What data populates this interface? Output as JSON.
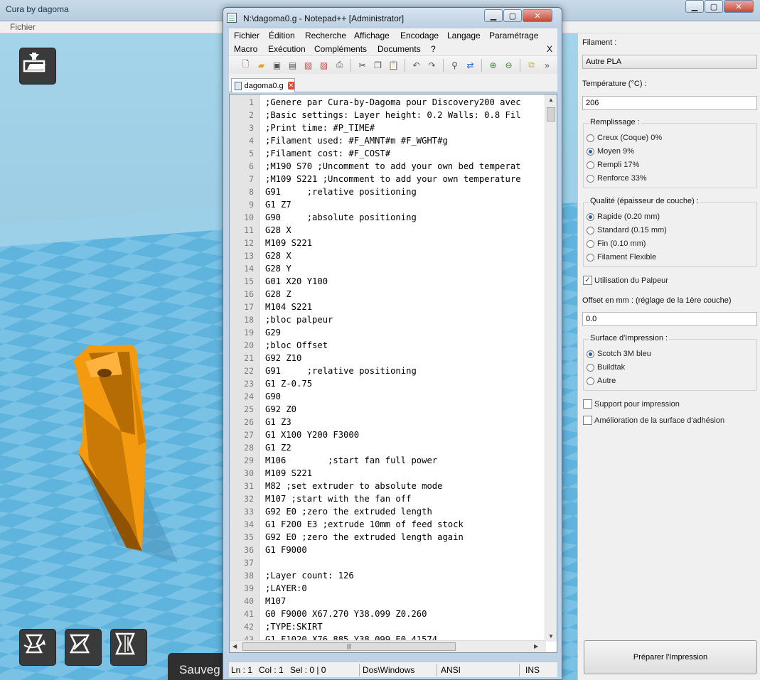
{
  "cura": {
    "title": "Cura by dagoma",
    "menu_fichier": "Fichier",
    "save_toast": "Sauveg"
  },
  "settings": {
    "filament_label": "Filament :",
    "filament_value": "Autre PLA",
    "temperature_label": "Température (°C) :",
    "temperature_value": "206",
    "remplissage": {
      "title": "Remplissage :",
      "options": [
        "Creux (Coque) 0%",
        "Moyen 9%",
        "Rempli 17%",
        "Renforce 33%"
      ],
      "selected_index": 1
    },
    "qualite": {
      "title": "Qualité (épaisseur de couche) :",
      "options": [
        "Rapide (0.20 mm)",
        "Standard (0.15 mm)",
        "Fin (0.10 mm)",
        "Filament Flexible"
      ],
      "selected_index": 0
    },
    "palpeur": {
      "label": "Utilisation du Palpeur",
      "checked": true
    },
    "offset_label": "Offset en mm : (réglage de la 1ère couche)",
    "offset_value": "0.0",
    "surface": {
      "title": "Surface d'Impression :",
      "options": [
        "Scotch 3M bleu",
        "Buildtak",
        "Autre"
      ],
      "selected_index": 0
    },
    "support": {
      "label": "Support pour impression",
      "checked": false
    },
    "adhesion": {
      "label": "Amélioration de la surface d'adhésion",
      "checked": false
    },
    "prepare_button": "Préparer l'Impression"
  },
  "notepad": {
    "title": "N:\\dagoma0.g - Notepad++ [Administrator]",
    "menu_row1": [
      "Fichier",
      "Édition",
      "Recherche",
      "Affichage",
      "Encodage",
      "Langage",
      "Paramétrage"
    ],
    "menu_row2": [
      "Macro",
      "Exécution",
      "Compléments",
      "Documents",
      "?"
    ],
    "menu_close": "X",
    "tab_name": "dagoma0.g",
    "lines": [
      ";Genere par Cura-by-Dagoma pour Discovery200 avec",
      ";Basic settings: Layer height: 0.2 Walls: 0.8 Fil",
      ";Print time: #P_TIME#",
      ";Filament used: #F_AMNT#m #F_WGHT#g",
      ";Filament cost: #F_COST#",
      ";M190 S70 ;Uncomment to add your own bed temperat",
      ";M109 S221 ;Uncomment to add your own temperature",
      "G91     ;relative positioning",
      "G1 Z7",
      "G90     ;absolute positioning",
      "G28 X",
      "M109 S221",
      "G28 X",
      "G28 Y",
      "G01 X20 Y100",
      "G28 Z",
      "M104 S221",
      ";bloc palpeur",
      "G29",
      ";bloc Offset",
      "G92 Z10",
      "G91     ;relative positioning",
      "G1 Z-0.75",
      "G90",
      "G92 Z0",
      "G1 Z3",
      "G1 X100 Y200 F3000",
      "G1 Z2",
      "M106        ;start fan full power",
      "M109 S221",
      "M82 ;set extruder to absolute mode",
      "M107 ;start with the fan off",
      "G92 E0 ;zero the extruded length",
      "G1 F200 E3 ;extrude 10mm of feed stock",
      "G92 E0 ;zero the extruded length again",
      "G1 F9000",
      "",
      ";Layer count: 126",
      ";LAYER:0",
      "M107",
      "G0 F9000 X67.270 Y38.099 Z0.260",
      ";TYPE:SKIRT",
      "G1 F1020 X76.885 Y38.099 E0.41574"
    ],
    "status": {
      "ln": "Ln : 1",
      "col": "Col : 1",
      "sel": "Sel : 0 | 0",
      "eol": "Dos\\Windows",
      "encoding": "ANSI",
      "mode": "INS"
    }
  },
  "colors": {
    "model_orange": "#f0930a",
    "bed_blue": "#5fb4dd",
    "bed_blue_light": "#79c2e6",
    "sky_blue": "#a6d6ec"
  }
}
